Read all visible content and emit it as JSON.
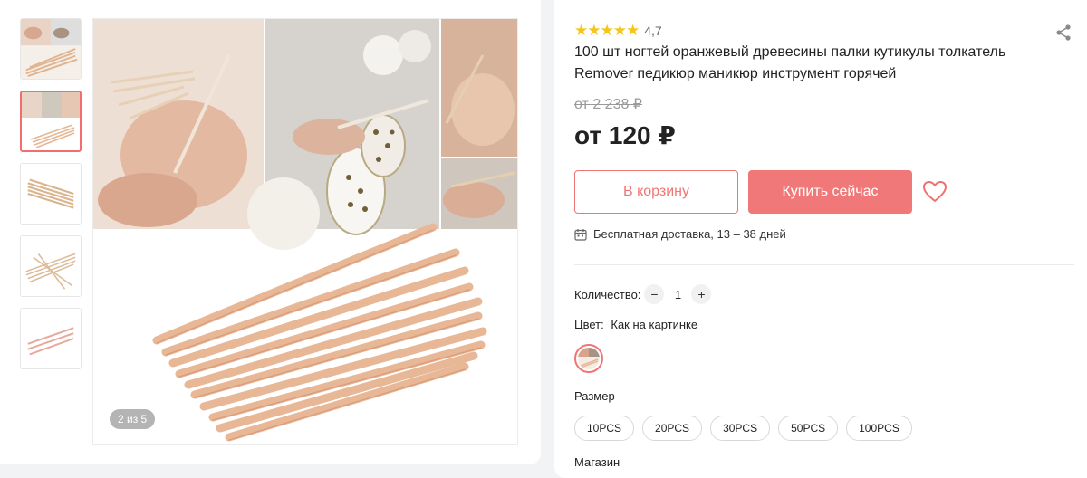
{
  "gallery": {
    "counter": "2 из 5",
    "thumbnail_count": 5,
    "active_index": 1
  },
  "product": {
    "rating_stars": "★★★★★",
    "rating_value": "4,7",
    "title": "100 шт ногтей оранжевый древесины палки кутикулы толкатель Remover педикюр маникюр инструмент горячей",
    "old_price": "от 2 238 ₽",
    "price": "от 120 ₽"
  },
  "actions": {
    "cart_label": "В корзину",
    "buy_label": "Купить сейчас"
  },
  "delivery": {
    "text": "Бесплатная доставка, 13 – 38 дней"
  },
  "quantity": {
    "label": "Количество:",
    "minus": "−",
    "value": "1",
    "plus": "+"
  },
  "color": {
    "label": "Цвет:",
    "value": "Как на картинке"
  },
  "size": {
    "label": "Размер",
    "options": [
      "10PCS",
      "20PCS",
      "30PCS",
      "50PCS",
      "100PCS"
    ]
  },
  "shop": {
    "label": "Магазин"
  },
  "colors": {
    "accent": "#f07878",
    "star": "#f5c518"
  }
}
